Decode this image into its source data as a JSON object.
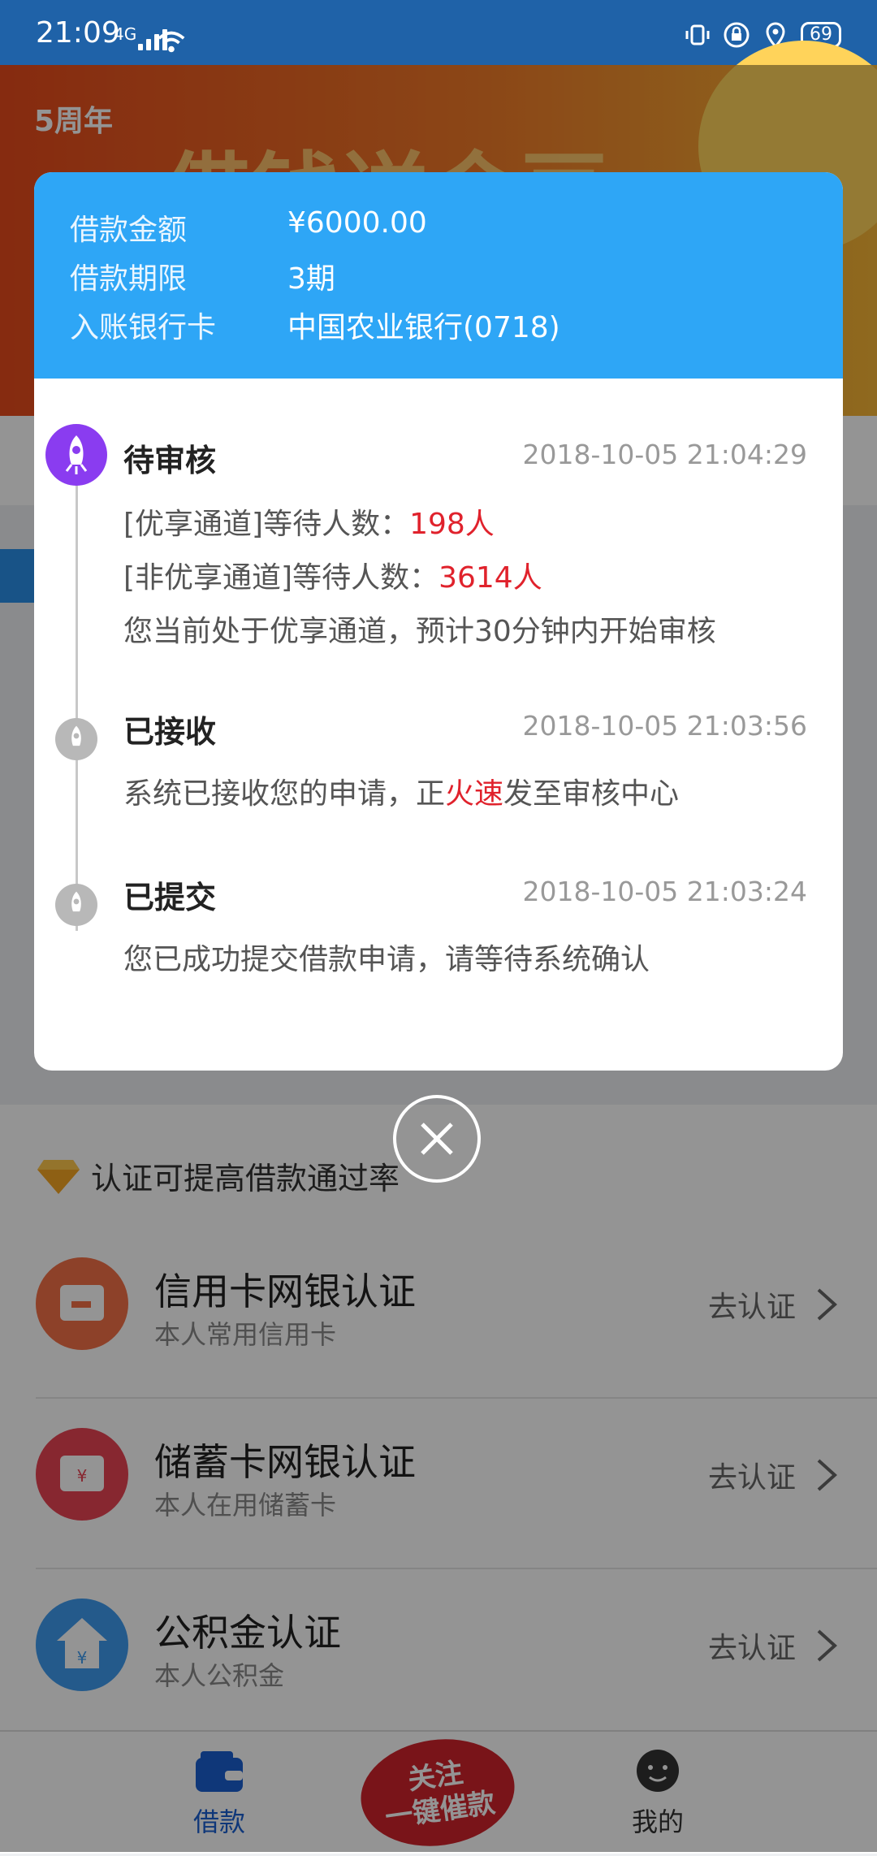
{
  "status": {
    "time": "21:09",
    "network": "4G",
    "battery": "69"
  },
  "banner": {
    "logo_text": "5周年",
    "headline": "借钱送金豆"
  },
  "modal": {
    "summary": [
      {
        "key": "借款金额",
        "value": "¥6000.00"
      },
      {
        "key": "借款期限",
        "value": "3期"
      },
      {
        "key": "入账银行卡",
        "value": "中国农业银行(0718)"
      }
    ],
    "steps": [
      {
        "title": "待审核",
        "time": "2018-10-05 21:04:29",
        "line1_prefix": "[优享通道]等待人数：",
        "line1_value": "198人",
        "line2_prefix": "[非优享通道]等待人数：",
        "line2_value": "3614人",
        "line3": "您当前处于优享通道，预计30分钟内开始审核"
      },
      {
        "title": "已接收",
        "time": "2018-10-05 21:03:56",
        "desc_a": "系统已接收您的申请，正",
        "desc_hl": "火速",
        "desc_b": "发至审核中心"
      },
      {
        "title": "已提交",
        "time": "2018-10-05 21:03:24",
        "desc": "您已成功提交借款申请，请等待系统确认"
      }
    ],
    "colors": {
      "header": "#2ea6f6",
      "active_step": "#8a3cf0",
      "highlight": "#e0222c"
    }
  },
  "certification": {
    "heading": "认证可提高借款通过率",
    "items": [
      {
        "title": "信用卡网银认证",
        "subtitle": "本人常用信用卡",
        "action": "去认证",
        "icon": "credit-card-icon"
      },
      {
        "title": "储蓄卡网银认证",
        "subtitle": "本人在用储蓄卡",
        "action": "去认证",
        "icon": "debit-card-icon"
      },
      {
        "title": "公积金认证",
        "subtitle": "本人公积金",
        "action": "去认证",
        "icon": "house-fund-icon"
      }
    ]
  },
  "tabbar": {
    "loan": "借款",
    "center_line1": "关注",
    "center_line2": "一键催款",
    "mine": "我的"
  }
}
